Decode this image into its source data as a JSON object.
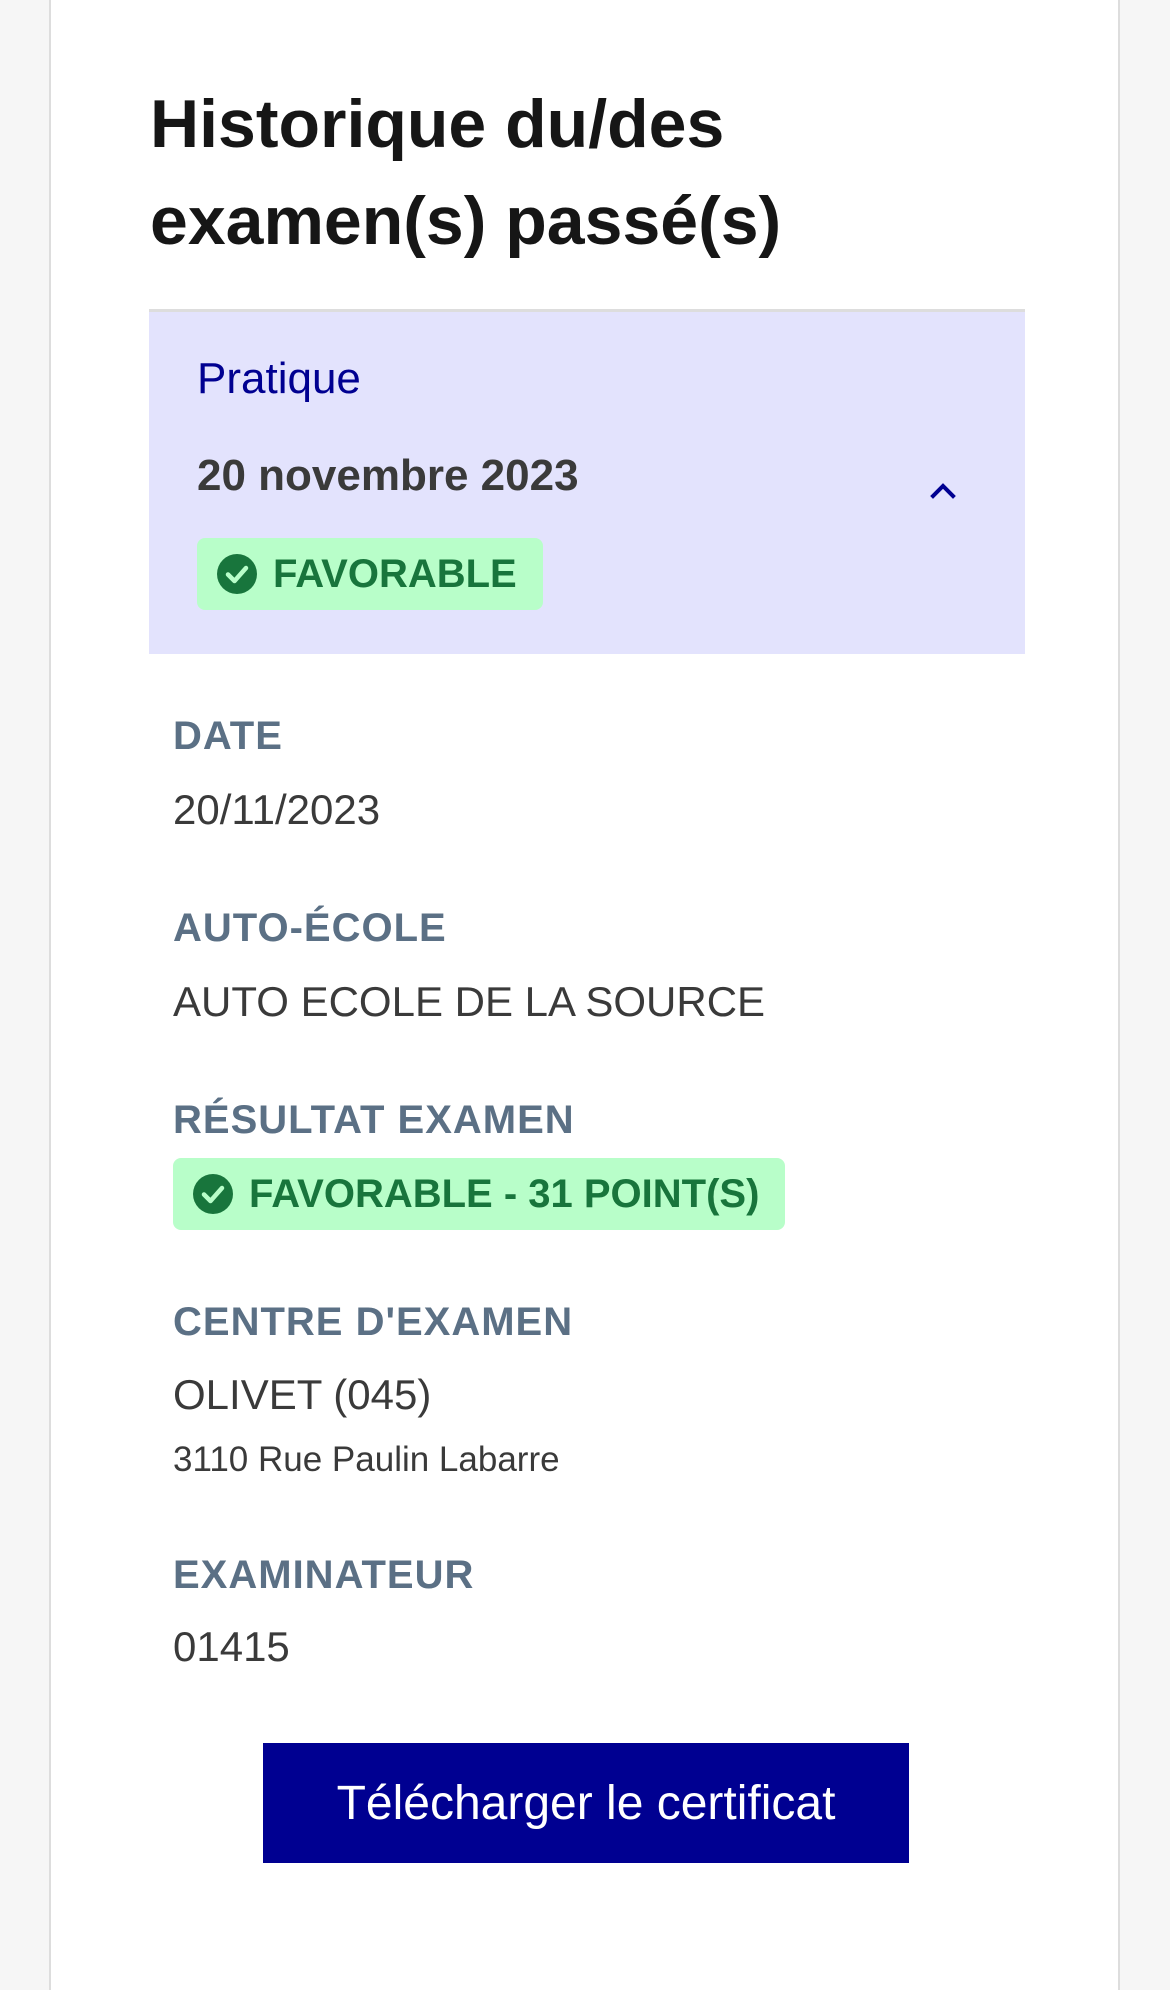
{
  "page": {
    "title": "Historique du/des examen(s) passé(s)"
  },
  "exam": {
    "type": "Pratique",
    "date_long": "20 novembre 2023",
    "status_badge": "FAVORABLE",
    "fields": {
      "date_label": "DATE",
      "date_value": "20/11/2023",
      "school_label": "AUTO-ÉCOLE",
      "school_value": "AUTO ECOLE DE LA SOURCE",
      "result_label": "RÉSULTAT EXAMEN",
      "result_value": "FAVORABLE - 31 POINT(S)",
      "center_label": "CENTRE D'EXAMEN",
      "center_value": "OLIVET (045)",
      "center_address": "3110 Rue Paulin Labarre",
      "examiner_label": "EXAMINATEUR",
      "examiner_value": "01415"
    }
  },
  "actions": {
    "download_label": "Télécharger le certificat"
  },
  "icons": {
    "chevron": "chevron-up-icon",
    "status": "check-circle-icon"
  },
  "colors": {
    "primary": "#000091",
    "accordion_bg": "#e3e3fd",
    "success_bg": "#b8fec9",
    "success_text": "#18753c",
    "label_text": "#5b7085"
  }
}
